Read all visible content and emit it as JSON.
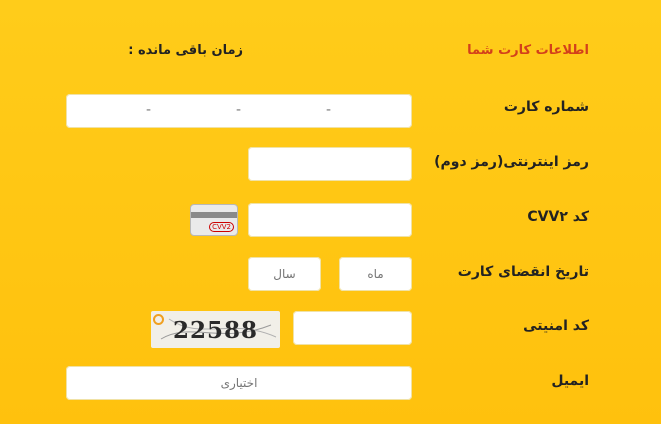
{
  "header": {
    "card_info_title": "اطلاعات کارت شما",
    "time_remaining_label": "زمان باقی مانده :"
  },
  "form": {
    "card_number_label": "شماره کارت",
    "card_number_separator": "-",
    "internet_password_label": "رمز اینترنتی(رمز دوم)",
    "cvv2_label": "کد CVV۲",
    "cvv_card_tag": "CVV2",
    "expiry_label": "تاریخ انقضای کارت",
    "month_placeholder": "ماه",
    "year_placeholder": "سال",
    "security_code_label": "کد امنیتی",
    "captcha_text": "22588",
    "email_label": "ایمیل",
    "email_placeholder": "اختیاری"
  }
}
